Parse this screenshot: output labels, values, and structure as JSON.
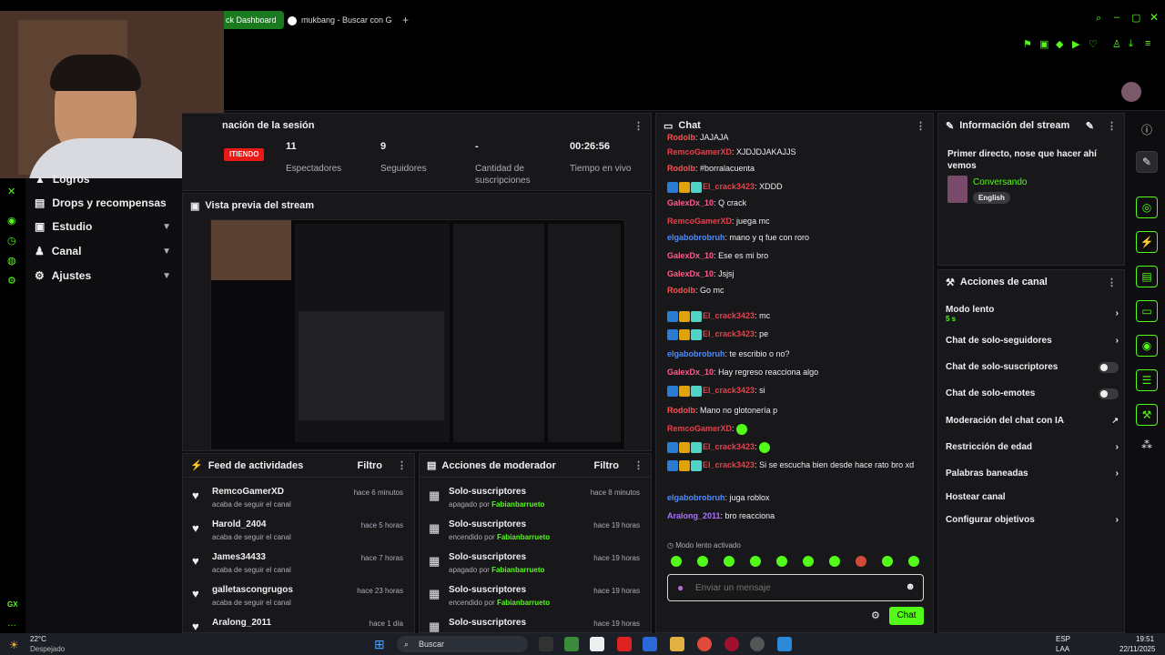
{
  "browser": {
    "tab_active": "ck Dashboard",
    "tab_second": "mukbang - Buscar con G",
    "new_tab": "+"
  },
  "session": {
    "title": "nación de la sesión",
    "live_badge": "ITIENDO",
    "stats": [
      {
        "value": "11",
        "label": "Espectadores"
      },
      {
        "value": "9",
        "label": "Seguidores"
      },
      {
        "value": "-",
        "label": "Cantidad de suscripciones"
      },
      {
        "value": "00:26:56",
        "label": "Tiempo en vivo"
      }
    ]
  },
  "leftnav": {
    "items": [
      {
        "label": "Logros"
      },
      {
        "label": "Drops y recompensas"
      },
      {
        "label": "Estudio"
      },
      {
        "label": "Canal"
      },
      {
        "label": "Ajustes"
      }
    ],
    "rail_bottom": "GX"
  },
  "preview": {
    "title": "Vista previa del stream"
  },
  "activity": {
    "title": "Feed de actividades",
    "filter": "Filtro",
    "rows": [
      {
        "name": "RemcoGamerXD",
        "sub": "acaba de seguir el canal",
        "time": "hace 6 minutos"
      },
      {
        "name": "Harold_2404",
        "sub": "acaba de seguir el canal",
        "time": "hace 5 horas"
      },
      {
        "name": "James34433",
        "sub": "acaba de seguir el canal",
        "time": "hace 7 horas"
      },
      {
        "name": "galletascongrugos",
        "sub": "acaba de seguir el canal",
        "time": "hace 23 horas"
      },
      {
        "name": "Aralong_2011",
        "sub": "",
        "time": "hace 1 día"
      }
    ]
  },
  "modactions": {
    "title": "Acciones de moderador",
    "filter": "Filtro",
    "rows": [
      {
        "name": "Solo-suscriptores",
        "pre": "apagado por ",
        "by": "Fabianbarrueto",
        "time": "hace 8 minutos"
      },
      {
        "name": "Solo-suscriptores",
        "pre": "encendido por ",
        "by": "Fabianbarrueto",
        "time": "hace 19 horas"
      },
      {
        "name": "Solo-suscriptores",
        "pre": "apagado por ",
        "by": "Fabianbarrueto",
        "time": "hace 19 horas"
      },
      {
        "name": "Solo-suscriptores",
        "pre": "encendido por ",
        "by": "Fabianbarrueto",
        "time": "hace 19 horas"
      },
      {
        "name": "Solo-suscriptores",
        "pre": "",
        "by": "",
        "time": "hace 19 horas"
      }
    ]
  },
  "chat": {
    "title": "Chat",
    "messages": [
      {
        "user": "Rodolb",
        "color": "#ff4f4f",
        "badges": false,
        "text": "JAJAJA"
      },
      {
        "user": "RemcoGamerXD",
        "color": "#e8404a",
        "badges": false,
        "text": "XJDJDJAKAJJS"
      },
      {
        "user": "Rodolb",
        "color": "#ff4f4f",
        "badges": false,
        "text": "#borralacuenta"
      },
      {
        "user": "El_crack3423",
        "color": "#e8404a",
        "badges": true,
        "text": "XDDD"
      },
      {
        "user": "GalexDx_10",
        "color": "#ff5c8a",
        "badges": false,
        "text": "Q crack"
      },
      {
        "user": "RemcoGamerXD",
        "color": "#e8404a",
        "badges": false,
        "text": "juega mc"
      },
      {
        "user": "elgabobrobruh",
        "color": "#4f8cff",
        "badges": false,
        "text": "mano y q fue con roro"
      },
      {
        "user": "GalexDx_10",
        "color": "#ff5c8a",
        "badges": false,
        "text": "Ese es mi bro"
      },
      {
        "user": "GalexDx_10",
        "color": "#ff5c8a",
        "badges": false,
        "text": "Jsjsj"
      },
      {
        "user": "Rodolb",
        "color": "#ff4f4f",
        "badges": false,
        "text": "Go mc"
      },
      {
        "user": "El_crack3423",
        "color": "#e8404a",
        "badges": true,
        "text": "mc"
      },
      {
        "user": "El_crack3423",
        "color": "#e8404a",
        "badges": true,
        "text": "pe"
      },
      {
        "user": "elgabobrobruh",
        "color": "#4f8cff",
        "badges": false,
        "text": "te escribio o no?"
      },
      {
        "user": "GalexDx_10",
        "color": "#ff5c8a",
        "badges": false,
        "text": "Hay regreso reacciona algo"
      },
      {
        "user": "El_crack3423",
        "color": "#e8404a",
        "badges": true,
        "text": "si"
      },
      {
        "user": "Rodolb",
        "color": "#ff4f4f",
        "badges": false,
        "text": "Mano no glotonería p"
      },
      {
        "user": "RemcoGamerXD",
        "color": "#e8404a",
        "badges": false,
        "text": ""
      },
      {
        "user": "El_crack3423",
        "color": "#e8404a",
        "badges": true,
        "text": ""
      },
      {
        "user": "El_crack3423",
        "color": "#e8404a",
        "badges": true,
        "text": "Si se escucha bien desde hace rato bro xd"
      },
      {
        "user": "elgabobrobruh",
        "color": "#4f8cff",
        "badges": false,
        "text": "juga roblox"
      },
      {
        "user": "Aralong_2011",
        "color": "#a970ff",
        "badges": false,
        "text": "bro reacciona"
      }
    ],
    "slow_mode": "Modo lento activado",
    "placeholder": "Enviar un mensaje",
    "send": "Chat"
  },
  "streaminfo": {
    "title": "Información del stream",
    "stream_title": "Primer directo, nose que hacer ahí vemos",
    "category": "Conversando",
    "tag": "English"
  },
  "channelactions": {
    "title": "Acciones de canal",
    "slow_label": "Modo lento",
    "slow_value": "5 s",
    "followers_only": "Chat de solo-seguidores",
    "subs_only": "Chat de solo-suscriptores",
    "emotes_only": "Chat de solo-emotes",
    "ai_mod": "Moderación del chat con IA",
    "age": "Restricción de edad",
    "banned": "Palabras baneadas",
    "host": "Hostear canal",
    "goals": "Configurar objetivos"
  },
  "taskbar": {
    "temp": "22°C",
    "weather": "Despejado",
    "search": "Buscar",
    "lang": "ESP",
    "lang2": "LAA",
    "time": "19:51",
    "date": "22/11/2025"
  },
  "colors": {
    "accent": "#53fc18",
    "panel": "#18181b",
    "bg": "#0e0e10"
  }
}
